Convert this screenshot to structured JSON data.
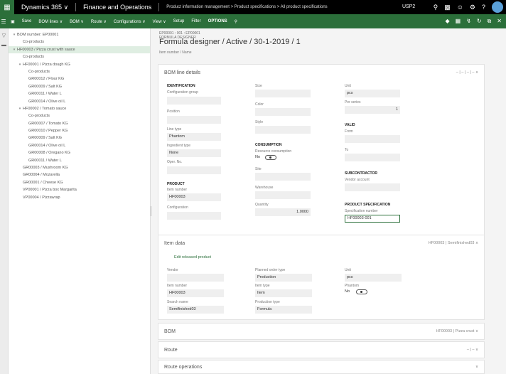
{
  "app": {
    "name": "Dynamics 365",
    "name_chevron": "∨",
    "module": "Finance and Operations",
    "breadcrumb": "Product information management  >  Product specifications  >  All product specifications",
    "company": "USP2"
  },
  "actions": [
    "Save",
    "BOM lines ∨",
    "BOM ∨",
    "Route ∨",
    "Configurations ∨",
    "View ∨",
    "Setup",
    "Filter",
    "OPTIONS"
  ],
  "tree": [
    {
      "text": "BOM number: EP00001",
      "caret": "▾",
      "indent": 0
    },
    {
      "text": "Co-products",
      "caret": "",
      "indent": 1
    },
    {
      "text": "HF00003 / Pizza crust with sauce",
      "caret": "▾",
      "indent": 0
    },
    {
      "text": "Co-products",
      "caret": "",
      "indent": 1
    },
    {
      "text": "HF00001 / Pizza dough KG",
      "caret": "▾",
      "indent": 1
    },
    {
      "text": "Co-products",
      "caret": "",
      "indent": 2
    },
    {
      "text": "GR00012 / Flour KG",
      "caret": "",
      "indent": 2
    },
    {
      "text": "GR00009 / Salt KG",
      "caret": "",
      "indent": 2
    },
    {
      "text": "GR00011 / Water L",
      "caret": "",
      "indent": 2
    },
    {
      "text": "GR00014 / Olive oil L",
      "caret": "",
      "indent": 2
    },
    {
      "text": "HF00002 / Tomato sauce",
      "caret": "▾",
      "indent": 1
    },
    {
      "text": "Co-products",
      "caret": "",
      "indent": 2
    },
    {
      "text": "GR00007 / Tomato KG",
      "caret": "",
      "indent": 2
    },
    {
      "text": "GR00010 / Pepper KG",
      "caret": "",
      "indent": 2
    },
    {
      "text": "GR00009 / Salt KG",
      "caret": "",
      "indent": 2
    },
    {
      "text": "GR00014 / Olive oil L",
      "caret": "",
      "indent": 2
    },
    {
      "text": "GR00008 / Oregano KG",
      "caret": "",
      "indent": 2
    },
    {
      "text": "GR00011 / Water L",
      "caret": "",
      "indent": 2
    },
    {
      "text": "GR00003 / Mushroom KG",
      "caret": "",
      "indent": 1
    },
    {
      "text": "GR00004 / Mozarella",
      "caret": "",
      "indent": 1
    },
    {
      "text": "GR00001 / Cheese KG",
      "caret": "",
      "indent": 1
    },
    {
      "text": "VP00001 / Pizza box Margarita",
      "caret": "",
      "indent": 1
    },
    {
      "text": "VP00004 / Pizzawrap",
      "caret": "",
      "indent": 1
    }
  ],
  "header": {
    "small_line1": "EP00001 : 001 : EP00001",
    "small_line2": "FORMULA DESIGNER",
    "title": "Formula designer / Active / 30-1-2019 / 1",
    "subtitle": "Item number / Name"
  },
  "bom_line": {
    "title": "BOM line details",
    "tools": "– | – | – | –   ∧",
    "identification": "IDENTIFICATION",
    "config_group_label": "Configuration group",
    "config_group_value": "",
    "position_label": "Position",
    "position_value": "",
    "line_type_label": "Line type",
    "line_type_value": "Phantom",
    "ingredient_type_label": "Ingredient type",
    "ingredient_type_value": "None",
    "oper_no_label": "Oper. No.",
    "oper_no_value": "",
    "product": "PRODUCT",
    "item_number_label": "Item number",
    "item_number_value": "HF00003",
    "configuration_label": "Configuration",
    "configuration_value": "",
    "size_label": "Size",
    "size_value": "",
    "color_label": "Color",
    "color_value": "",
    "style_label": "Style",
    "style_value": "",
    "consumption": "CONSUMPTION",
    "resource_consumption_label": "Resource consumption",
    "resource_consumption_value": "No",
    "site_label": "Site",
    "site_value": "",
    "warehouse_label": "Warehouse",
    "warehouse_value": "",
    "quantity_label": "Quantity",
    "quantity_value": "1.0000",
    "unit_label": "Unit",
    "unit_value": "pcs",
    "per_series_label": "Per series",
    "per_series_value": "1",
    "valid": "VALID",
    "from_label": "From",
    "from_value": "",
    "to_label": "To",
    "to_value": "",
    "subcontractor": "SUBCONTRACTOR",
    "vendor_account_label": "Vendor account",
    "vendor_account_value": "",
    "product_spec": "PRODUCT SPECIFICATION",
    "spec_number_label": "Specification number",
    "spec_number_value": "HF00003-001"
  },
  "item_data": {
    "title": "Item data",
    "tools": "HF00003  |  Semifinished03   ∧",
    "edit_link": "Edit released product",
    "vendor_label": "Vendor",
    "vendor_value": "",
    "item_number_label": "Item number",
    "item_number_value": "HF00003",
    "search_name_label": "Search name",
    "search_name_value": "Semifinished03",
    "planned_order_type_label": "Planned order type",
    "planned_order_type_value": "Production",
    "item_type_label": "Item type",
    "item_type_value": "Item",
    "production_type_label": "Production type",
    "production_type_value": "Formula",
    "unit_label": "Unit",
    "unit_value": "pcs",
    "phantom_label": "Phantom",
    "phantom_value": "No"
  },
  "bom": {
    "title": "BOM",
    "tools": "HF00003  |  Pizza crust   ∨"
  },
  "route": {
    "title": "Route",
    "tools": "– | –   ∨"
  },
  "route_ops": {
    "title": "Route operations",
    "tools": "∨"
  }
}
